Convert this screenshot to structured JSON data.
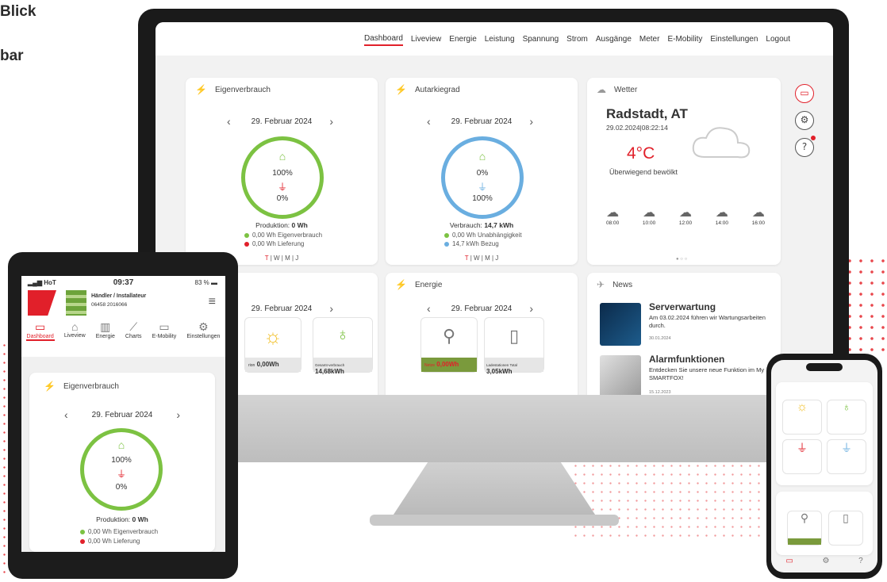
{
  "headline": {
    "line1": "Blick",
    "line2": "bar"
  },
  "nav": [
    "Dashboard",
    "Liveview",
    "Energie",
    "Leistung",
    "Spannung",
    "Strom",
    "Ausgänge",
    "Meter",
    "E-Mobility",
    "Einstellungen",
    "Logout"
  ],
  "eigen": {
    "title": "Eigenverbrauch",
    "date": "29. Februar 2024",
    "top": "100%",
    "bottom": "0%",
    "prod_label": "Produktion:",
    "prod_val": "0 Wh",
    "leg1": "0,00 Wh Eigenverbrauch",
    "leg2": "0,00 Wh Lieferung",
    "twmj": "T | W | M | J",
    "t": "T"
  },
  "autark": {
    "title": "Autarkiegrad",
    "date": "29. Februar 2024",
    "top": "0%",
    "bottom": "100%",
    "verb_label": "Verbrauch:",
    "verb_val": "14,7 kWh",
    "leg1": "0,00 Wh Unabhängigkeit",
    "leg2": "14,7 kWh Bezug",
    "twmj": "T | W | M | J",
    "t": "T"
  },
  "weather": {
    "title": "Wetter",
    "city": "Radstadt, AT",
    "datetime": "29.02.2024|08:22:14",
    "temp": "4°C",
    "desc": "Überwiegend bewölkt",
    "hours": [
      "08:00",
      "10:00",
      "12:00",
      "14:00",
      "16:00"
    ]
  },
  "energie1": {
    "title": "ergie",
    "date": "29. Februar 2024",
    "pv_label": "rion",
    "pv_val": "0,00Wh",
    "cons_label": "Gesamt-verbrauch",
    "cons_val": "14,68kWh"
  },
  "energie2": {
    "title": "Energie",
    "date": "29. Februar 2024",
    "c1_label": "Netze",
    "c1_val": "0,00Wh",
    "c2_label": "Ladestationen Total",
    "c2_val": "3,05kWh"
  },
  "news": {
    "title": "News",
    "items": [
      {
        "title": "Serverwartung",
        "text": "Am 03.02.2024 führen wir Wartungsarbeiten durch.",
        "date": "30.01.2024"
      },
      {
        "title": "Alarmfunktionen",
        "text": "Entdecken Sie unsere neue Funktion im My SMARTFOX!",
        "date": "15.12.2023"
      }
    ]
  },
  "tablet": {
    "carrier": "HoT",
    "time": "09:37",
    "battery": "83 %",
    "role": "Händler / Installateur",
    "phone": "06458 2016066",
    "tabs": [
      "Dashboard",
      "Liveview",
      "Energie",
      "Charts",
      "E-Mobility",
      "Einstellungen"
    ],
    "card_title": "Eigenverbrauch",
    "date": "29. Februar 2024",
    "top": "100%",
    "bottom": "0%",
    "prod_label": "Produktion:",
    "prod_val": "0 Wh",
    "leg1": "0,00 Wh Eigenverbrauch",
    "leg2": "0,00 Wh Lieferung"
  },
  "colors": {
    "green": "#7cc242",
    "blue": "#6aaee0",
    "red": "#e1202a",
    "olive": "#7a9a3c"
  }
}
